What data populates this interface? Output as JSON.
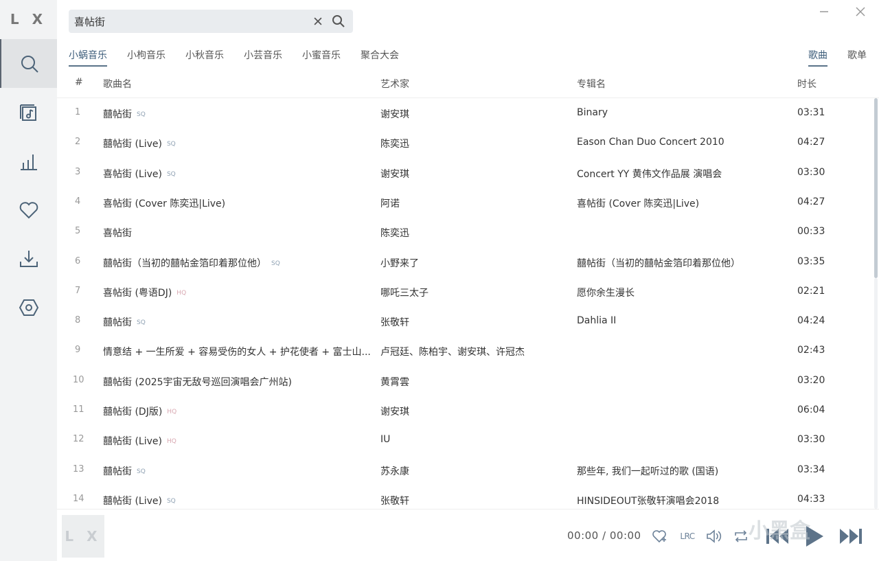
{
  "app": {
    "logo": "L X"
  },
  "sidebar": {
    "items": [
      {
        "name": "search",
        "icon": "search-icon"
      },
      {
        "name": "playlist",
        "icon": "music-list-icon"
      },
      {
        "name": "leaderboard",
        "icon": "bar-chart-icon"
      },
      {
        "name": "favorites",
        "icon": "heart-icon"
      },
      {
        "name": "download",
        "icon": "download-icon"
      },
      {
        "name": "settings",
        "icon": "hexagon-settings-icon"
      }
    ]
  },
  "search": {
    "value": "喜帖街"
  },
  "source_tabs": [
    "小蜗音乐",
    "小枸音乐",
    "小秋音乐",
    "小芸音乐",
    "小蜜音乐",
    "聚合大会"
  ],
  "type_tabs": [
    "歌曲",
    "歌单"
  ],
  "table": {
    "headers": {
      "num": "#",
      "name": "歌曲名",
      "artist": "艺术家",
      "album": "专辑名",
      "duration": "时长"
    },
    "rows": [
      {
        "num": "1",
        "name": "囍帖街",
        "quality": "SQ",
        "artist": "谢安琪",
        "album": "Binary",
        "duration": "03:31"
      },
      {
        "num": "2",
        "name": "囍帖街 (Live)",
        "quality": "SQ",
        "artist": "陈奕迅",
        "album": "Eason Chan Duo Concert 2010",
        "duration": "04:27"
      },
      {
        "num": "3",
        "name": "喜帖街 (Live)",
        "quality": "SQ",
        "artist": "谢安琪",
        "album": "Concert YY 黄伟文作品展 演唱会",
        "duration": "03:30"
      },
      {
        "num": "4",
        "name": "喜帖街 (Cover 陈奕迅|Live)",
        "quality": "",
        "artist": "阿诺",
        "album": "喜帖街 (Cover 陈奕迅|Live)",
        "duration": "04:27"
      },
      {
        "num": "5",
        "name": "喜帖街",
        "quality": "",
        "artist": "陈奕迅",
        "album": "",
        "duration": "00:33"
      },
      {
        "num": "6",
        "name": "囍帖街（当初的囍帖金箔印着那位他）",
        "quality": "SQ",
        "artist": "小野来了",
        "album": "囍帖街（当初的囍帖金箔印着那位他）",
        "duration": "03:35"
      },
      {
        "num": "7",
        "name": "喜帖街 (粤语DJ)",
        "quality": "HQ",
        "artist": "哪吒三太子",
        "album": "愿你余生漫长",
        "duration": "02:21"
      },
      {
        "num": "8",
        "name": "囍帖街",
        "quality": "SQ",
        "artist": "张敬轩",
        "album": "Dahlia II",
        "duration": "04:24"
      },
      {
        "num": "9",
        "name": "情意结 + 一生所爱 + 容易受伤的女人 + 护花使者 + 富士山...",
        "quality": "",
        "artist": "卢冠廷、陈柏宇、谢安琪、许冠杰",
        "album": "",
        "duration": "02:43"
      },
      {
        "num": "10",
        "name": "囍帖街 (2025宇宙无敌号巡回演唱会广州站)",
        "quality": "",
        "artist": "黄霄雲",
        "album": "",
        "duration": "03:20"
      },
      {
        "num": "11",
        "name": "囍帖街 (DJ版)",
        "quality": "HQ",
        "artist": "谢安琪",
        "album": "",
        "duration": "06:04"
      },
      {
        "num": "12",
        "name": "囍帖街 (Live)",
        "quality": "HQ",
        "artist": "IU",
        "album": "",
        "duration": "03:30"
      },
      {
        "num": "13",
        "name": "囍帖街",
        "quality": "SQ",
        "artist": "苏永康",
        "album": "那些年, 我们一起听过的歌 (国语)",
        "duration": "03:34"
      },
      {
        "num": "14",
        "name": "囍帖街 (Live)",
        "quality": "SQ",
        "artist": "张敬轩",
        "album": "HINSIDEOUT张敬轩演唱会2018",
        "duration": "04:33"
      }
    ]
  },
  "player": {
    "cover_text": "L X",
    "current_time": "00:00",
    "separator": "/",
    "total_time": "00:00",
    "lyric_label": "LRC"
  },
  "watermark": "小黑盒",
  "colors": {
    "accent": "#3d5d7a",
    "sidebar_bg": "#f2f3f4",
    "sq_badge": "#8fa1b3",
    "hq_badge": "#d8a7b0"
  }
}
